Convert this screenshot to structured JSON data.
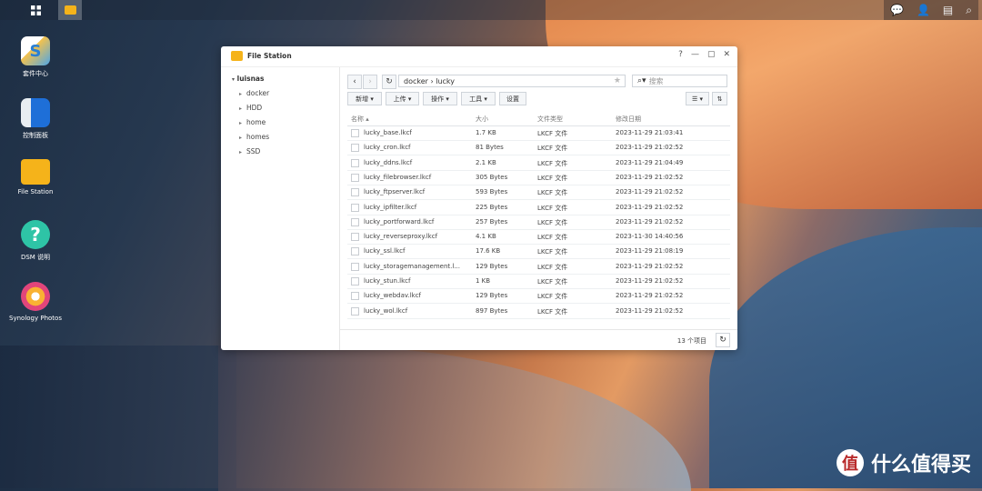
{
  "taskbar": {
    "menu_icon": "grid-icon",
    "app_icon": "file-station-icon",
    "right_icons": [
      "chat-icon",
      "user-icon",
      "widgets-icon",
      "search-icon"
    ]
  },
  "desktop_icons": [
    {
      "label": "套件中心"
    },
    {
      "label": "控制面板"
    },
    {
      "label": "File Station"
    },
    {
      "label": "DSM 说明"
    },
    {
      "label": "Synology Photos"
    }
  ],
  "window": {
    "title": "File Station",
    "controls": [
      "?",
      "—",
      "▢",
      "✕"
    ]
  },
  "sidebar": {
    "root": "luisnas",
    "items": [
      "docker",
      "HDD",
      "home",
      "homes",
      "SSD"
    ]
  },
  "nav": {
    "path": "docker › lucky",
    "search_placeholder": "搜索"
  },
  "toolbar": {
    "new": "新增 ▾",
    "upload": "上传 ▾",
    "action": "操作 ▾",
    "tools": "工具 ▾",
    "settings": "设置"
  },
  "table": {
    "headers": {
      "name": "名称 ▴",
      "size": "大小",
      "type": "文件类型",
      "modified": "修改日期"
    },
    "rows": [
      {
        "name": "lucky_base.lkcf",
        "size": "1.7 KB",
        "type": "LKCF 文件",
        "modified": "2023-11-29 21:03:41"
      },
      {
        "name": "lucky_cron.lkcf",
        "size": "81 Bytes",
        "type": "LKCF 文件",
        "modified": "2023-11-29 21:02:52"
      },
      {
        "name": "lucky_ddns.lkcf",
        "size": "2.1 KB",
        "type": "LKCF 文件",
        "modified": "2023-11-29 21:04:49"
      },
      {
        "name": "lucky_filebrowser.lkcf",
        "size": "305 Bytes",
        "type": "LKCF 文件",
        "modified": "2023-11-29 21:02:52"
      },
      {
        "name": "lucky_ftpserver.lkcf",
        "size": "593 Bytes",
        "type": "LKCF 文件",
        "modified": "2023-11-29 21:02:52"
      },
      {
        "name": "lucky_ipfilter.lkcf",
        "size": "225 Bytes",
        "type": "LKCF 文件",
        "modified": "2023-11-29 21:02:52"
      },
      {
        "name": "lucky_portforward.lkcf",
        "size": "257 Bytes",
        "type": "LKCF 文件",
        "modified": "2023-11-29 21:02:52"
      },
      {
        "name": "lucky_reverseproxy.lkcf",
        "size": "4.1 KB",
        "type": "LKCF 文件",
        "modified": "2023-11-30 14:40:56"
      },
      {
        "name": "lucky_ssl.lkcf",
        "size": "17.6 KB",
        "type": "LKCF 文件",
        "modified": "2023-11-29 21:08:19"
      },
      {
        "name": "lucky_storagemanagement.l...",
        "size": "129 Bytes",
        "type": "LKCF 文件",
        "modified": "2023-11-29 21:02:52"
      },
      {
        "name": "lucky_stun.lkcf",
        "size": "1 KB",
        "type": "LKCF 文件",
        "modified": "2023-11-29 21:02:52"
      },
      {
        "name": "lucky_webdav.lkcf",
        "size": "129 Bytes",
        "type": "LKCF 文件",
        "modified": "2023-11-29 21:02:52"
      },
      {
        "name": "lucky_wol.lkcf",
        "size": "897 Bytes",
        "type": "LKCF 文件",
        "modified": "2023-11-29 21:02:52"
      }
    ]
  },
  "status": {
    "count": "13 个项目"
  },
  "watermark": {
    "text": "什么值得买",
    "logo": "值"
  }
}
